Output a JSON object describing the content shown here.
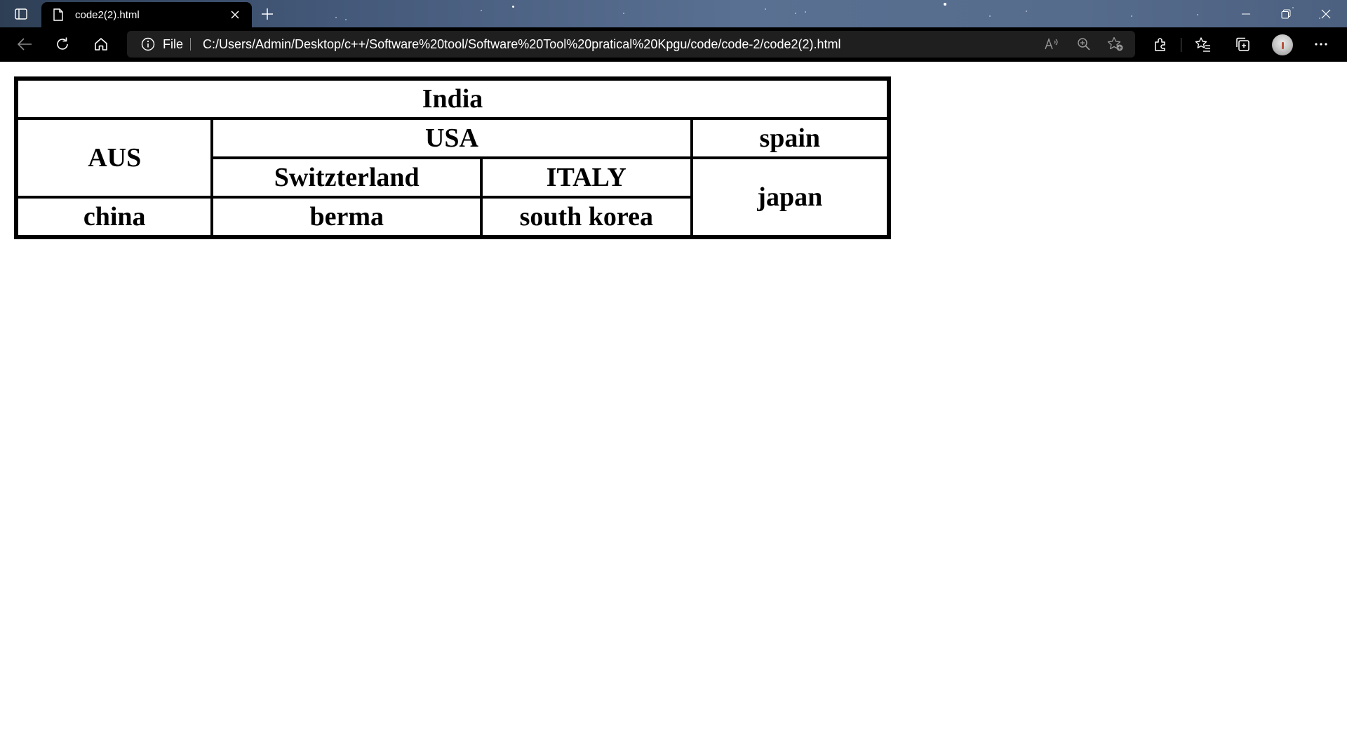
{
  "browser": {
    "tab": {
      "title": "code2(2).html"
    },
    "address_bar": {
      "scheme_label": "File",
      "url": "C:/Users/Admin/Desktop/c++/Software%20tool/Software%20Tool%20pratical%20Kpgu/code/code-2/code2(2).html"
    },
    "icons": [
      "tab-actions-icon",
      "page-icon",
      "close-icon",
      "plus-icon",
      "minimize-icon",
      "restore-icon",
      "close-window-icon",
      "back-arrow-icon",
      "refresh-icon",
      "home-icon",
      "info-icon",
      "read-aloud-icon",
      "zoom-icon",
      "add-favorite-icon",
      "extensions-icon",
      "favorites-icon",
      "collections-icon",
      "more-icon"
    ]
  },
  "page": {
    "table": {
      "rows": [
        [
          {
            "text": "India",
            "colspan": 4
          }
        ],
        [
          {
            "text": "AUS",
            "rowspan": 2
          },
          {
            "text": "USA",
            "colspan": 2
          },
          {
            "text": "spain"
          }
        ],
        [
          {
            "text": "Switzterland"
          },
          {
            "text": "ITALY"
          },
          {
            "text": "japan",
            "rowspan": 2
          }
        ],
        [
          {
            "text": "china"
          },
          {
            "text": "berma"
          },
          {
            "text": "south korea"
          }
        ]
      ]
    }
  }
}
